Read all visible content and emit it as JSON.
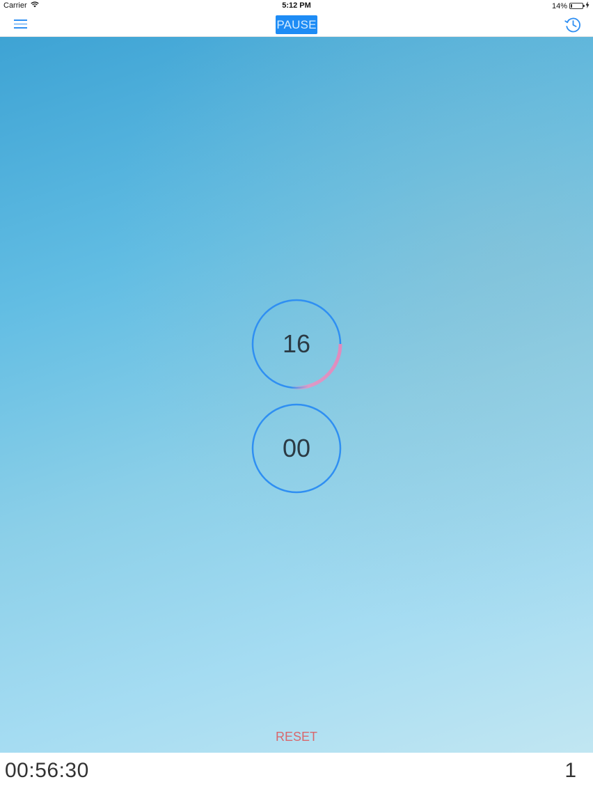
{
  "status_bar": {
    "carrier": "Carrier",
    "time": "5:12 PM",
    "battery_percent": "14%",
    "battery_level": 0.14
  },
  "nav": {
    "menu_icon": "hamburger-menu-icon",
    "pause_label": "PAUSE",
    "history_icon": "history-clock-icon"
  },
  "timer": {
    "seconds_value": "16",
    "seconds_progress": 0.27,
    "rounds_value": "00",
    "colors": {
      "ring": "#2f8ff2",
      "progress": "#e08bbd"
    }
  },
  "controls": {
    "reset_label": "RESET"
  },
  "footer": {
    "total_time": "00:56:30",
    "round_count": "1"
  },
  "colors": {
    "accent": "#1e8cf5",
    "reset": "#d8676c"
  }
}
